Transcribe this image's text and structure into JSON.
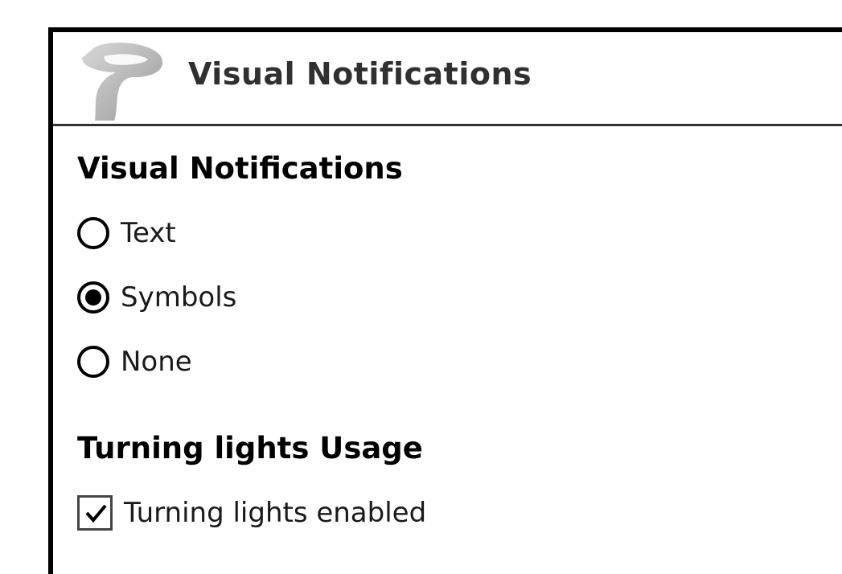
{
  "header": {
    "title": "Visual Notifications",
    "icon": "turn-sign-icon"
  },
  "visual_notifications": {
    "heading": "Visual Notifications",
    "options": [
      {
        "label": "Text",
        "selected": false
      },
      {
        "label": "Symbols",
        "selected": true
      },
      {
        "label": "None",
        "selected": false
      }
    ]
  },
  "turning_lights": {
    "heading": "Turning lights Usage",
    "checkbox_label": "Turning lights enabled",
    "checked": true
  }
}
